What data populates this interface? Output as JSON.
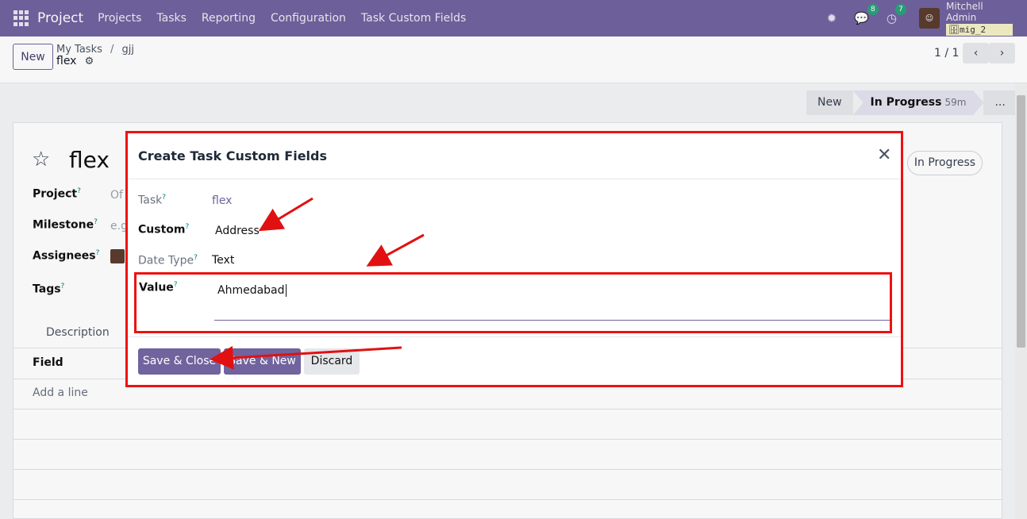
{
  "navbar": {
    "app_name": "Project",
    "menu": [
      "Projects",
      "Tasks",
      "Reporting",
      "Configuration",
      "Task Custom Fields"
    ],
    "messages_count": "8",
    "activities_count": "7",
    "user_name": "Mitchell Admin",
    "database": "mig_2"
  },
  "control": {
    "new_label": "New",
    "breadcrumb": [
      "My Tasks",
      "gjj"
    ],
    "current": "flex",
    "pager": "1 / 1"
  },
  "statusbar": {
    "stages": [
      "New",
      "In Progress",
      "..."
    ],
    "timer": "59m"
  },
  "record": {
    "title": "flex",
    "stage_pill": "In Progress",
    "fields": [
      {
        "label": "Project",
        "value": "Of"
      },
      {
        "label": "Milestone",
        "value": "e.g"
      },
      {
        "label": "Assignees",
        "value": ""
      },
      {
        "label": "Tags",
        "value": ""
      }
    ],
    "tab": "Description",
    "list_header": "Field",
    "add_line": "Add a line"
  },
  "modal": {
    "title": "Create Task Custom Fields",
    "fields": {
      "task_label": "Task",
      "task_value": "flex",
      "custom_label": "Custom",
      "custom_value": "Address",
      "type_label": "Date Type",
      "type_value": "Text",
      "value_label": "Value",
      "value_value": "Ahmedabad"
    },
    "buttons": {
      "save_close": "Save & Close",
      "save_new": "Save & New",
      "discard": "Discard"
    }
  },
  "colors": {
    "brand": "#71639e",
    "annotation": "#e11111"
  }
}
